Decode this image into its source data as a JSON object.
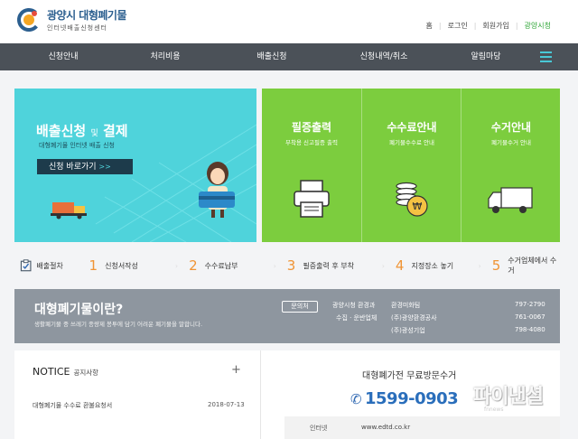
{
  "header": {
    "logo_title": "광양시 대형폐기물",
    "logo_subtitle": "인터넷배출신청센터",
    "links": [
      "홈",
      "로그인",
      "회원가입",
      "광양시청"
    ]
  },
  "nav": {
    "items": [
      "신청안내",
      "처리비용",
      "배출신청",
      "신청내역/취소",
      "알림마당"
    ]
  },
  "banner": {
    "title_part1": "배출신청",
    "title_joiner": "및",
    "title_part2": "결제",
    "subtitle": "대형폐기물 인터넷 배출 신청",
    "button_label": "신청 바로가기",
    "button_arrow": ">>"
  },
  "quick": [
    {
      "title": "필증출력",
      "subtitle": "부착용 신고필증 출력",
      "icon": "printer-icon"
    },
    {
      "title": "수수료안내",
      "subtitle": "폐기물수수료 안내",
      "icon": "coins-icon"
    },
    {
      "title": "수거안내",
      "subtitle": "폐기물수거 안내",
      "icon": "truck-icon"
    }
  ],
  "steps": {
    "label": "배출절차",
    "items": [
      {
        "num": "1",
        "text": "신청서작성"
      },
      {
        "num": "2",
        "text": "수수료납부"
      },
      {
        "num": "3",
        "text": "필증출력 후 부착"
      },
      {
        "num": "4",
        "text": "지정장소 놓기"
      },
      {
        "num": "5",
        "text": "수거업체에서 수거"
      }
    ]
  },
  "info": {
    "title": "대형폐기물이란?",
    "description": "생활폐기물 중 쓰레기 종량제 봉투에 담기 어려운 폐기물을 말합니다.",
    "inquiry_label": "문의처",
    "contacts": [
      {
        "org": "광양시청 환경과",
        "dept": "환경미화팀",
        "phone": "797-2790"
      },
      {
        "org": "수집 · 운반업체",
        "dept": "(주)광양환경공사",
        "phone": "761-0067"
      },
      {
        "org": "",
        "dept": "(주)광성기업",
        "phone": "798-4080"
      }
    ]
  },
  "notice": {
    "title": "NOTICE",
    "title_ko": "공지사항",
    "more": "+",
    "items": [
      {
        "text": "대형폐기물 수수료 환불요청서",
        "date": "2018-07-13"
      }
    ]
  },
  "visit": {
    "title": "대형폐가전 무료방문수거",
    "phone": "1599-0903",
    "web_label": "인터넷",
    "web_url": "www.edtd.co.kr"
  },
  "watermark": {
    "text": "파이낸셜",
    "sub": "fnnews"
  },
  "colors": {
    "nav_bg": "#4b5158",
    "teal": "#4fd3db",
    "green": "#7ccd3e",
    "orange": "#f09435",
    "gray_bar": "#8e969f",
    "phone_blue": "#2a6ebb"
  }
}
